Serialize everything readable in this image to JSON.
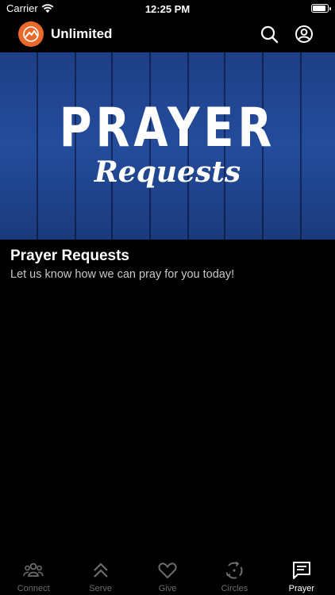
{
  "status": {
    "carrier": "Carrier",
    "time": "12:25 PM"
  },
  "header": {
    "title": "Unlimited",
    "logo_icon": "mountain-logo-icon",
    "accent": "#e8692a"
  },
  "hero": {
    "title": "PRAYER",
    "script": "Requests"
  },
  "section": {
    "title": "Prayer Requests",
    "subtitle": "Let us know how we can pray for you today!"
  },
  "tabs": [
    {
      "label": "Connect",
      "icon": "people-icon",
      "active": false
    },
    {
      "label": "Serve",
      "icon": "double-chevron-up-icon",
      "active": false
    },
    {
      "label": "Give",
      "icon": "heart-icon",
      "active": false
    },
    {
      "label": "Circles",
      "icon": "circle-arrows-icon",
      "active": false
    },
    {
      "label": "Prayer",
      "icon": "message-icon",
      "active": true
    }
  ]
}
